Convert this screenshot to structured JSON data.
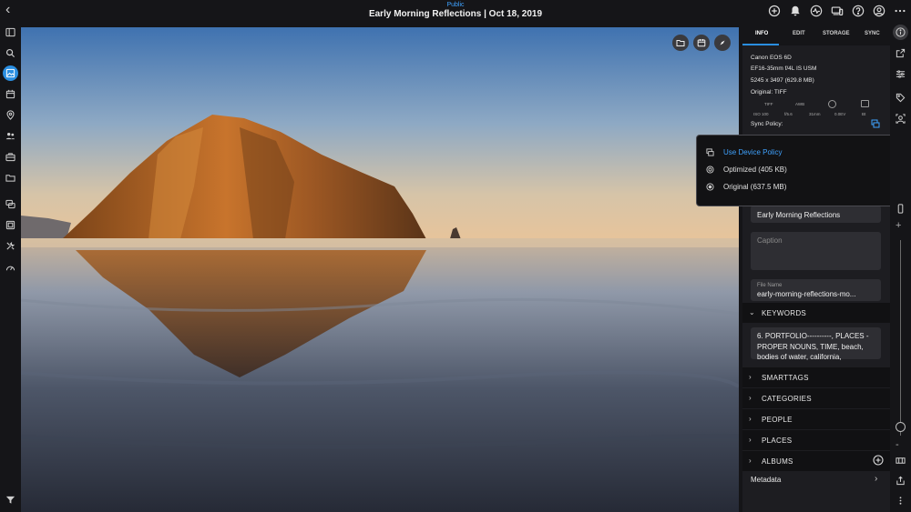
{
  "header": {
    "visibility": "Public",
    "title": "Early Morning Reflections | Oct 18, 2019",
    "icons": [
      "plus-circle-icon",
      "bell-icon",
      "activity-icon",
      "devices-icon",
      "help-icon",
      "account-icon",
      "more-icon"
    ]
  },
  "left_sidebar": {
    "items": [
      "sidebar-toggle",
      "search",
      "photos",
      "calendar",
      "places",
      "people",
      "jobs",
      "folders",
      "stacks",
      "albums",
      "tools",
      "dashboard",
      "filter"
    ],
    "active": "photos"
  },
  "photo": {
    "buttons": [
      "folder-icon",
      "calendar-icon",
      "compass-icon"
    ]
  },
  "info_panel": {
    "tabs": [
      "INFO",
      "EDIT",
      "STORAGE",
      "SYNC"
    ],
    "active_tab": "INFO",
    "camera": "Canon EOS 6D",
    "lens": "EF16-35mm f/4L IS USM",
    "dimensions": "5245 x 3497 (629.8 MB)",
    "original": "Original: TIFF",
    "exif_top": [
      "TIFF",
      "AWB"
    ],
    "exif_bottom": [
      "ISO 100",
      "f/5.6",
      "31mm",
      "0.0EV",
      "Bt"
    ],
    "sync_policy_label": "Sync Policy:",
    "title_value": "Early Morning Reflections",
    "caption_placeholder": "Caption",
    "file_name_label": "File Name",
    "file_name_value": "early-morning-reflections-mo...",
    "keywords_label": "KEYWORDS",
    "keywords_value": "6. PORTFOLIO----------, PLACES - PROPER NOUNS, TIME, beach, bodies of water, california,",
    "sections": [
      "SMARTTAGS",
      "CATEGORIES",
      "PEOPLE",
      "PLACES",
      "ALBUMS"
    ],
    "metadata_label": "Metadata"
  },
  "sync_dropdown": {
    "options": [
      {
        "label": "Use Device Policy",
        "selected": true
      },
      {
        "label": "Optimized (405 KB)",
        "selected": false
      },
      {
        "label": "Original (637.5 MB)",
        "selected": false
      }
    ]
  },
  "colors": {
    "accent": "#2a8ee0",
    "panel": "#1d1d21",
    "background": "#151518"
  }
}
